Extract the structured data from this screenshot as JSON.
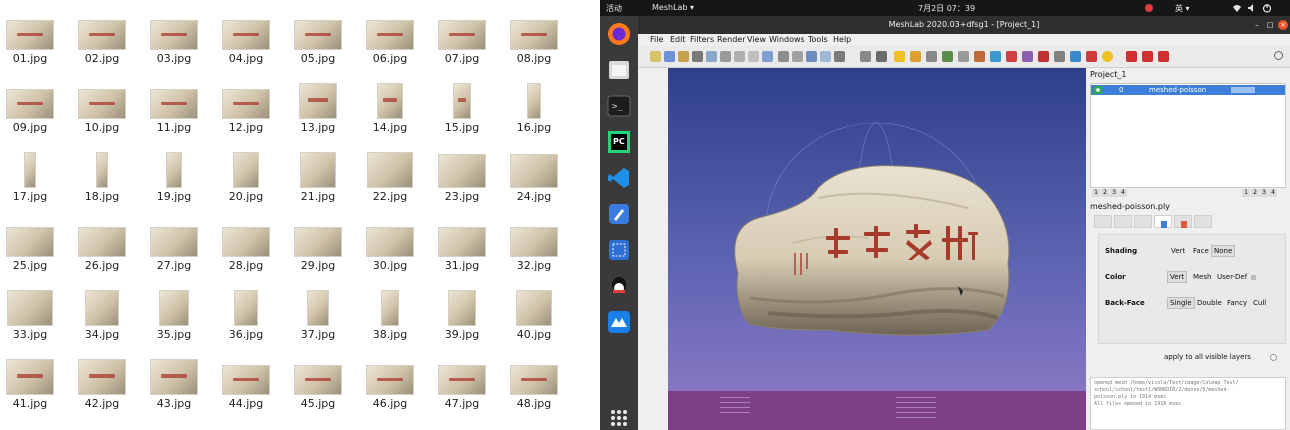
{
  "files": [
    {
      "name": "01.jpg",
      "w": 48,
      "h": 30,
      "text": true
    },
    {
      "name": "02.jpg",
      "w": 48,
      "h": 30,
      "text": true
    },
    {
      "name": "03.jpg",
      "w": 48,
      "h": 30,
      "text": true
    },
    {
      "name": "04.jpg",
      "w": 48,
      "h": 30,
      "text": true
    },
    {
      "name": "05.jpg",
      "w": 48,
      "h": 30,
      "text": true
    },
    {
      "name": "06.jpg",
      "w": 48,
      "h": 30,
      "text": true
    },
    {
      "name": "07.jpg",
      "w": 48,
      "h": 30,
      "text": true
    },
    {
      "name": "08.jpg",
      "w": 48,
      "h": 30,
      "text": true
    },
    {
      "name": "09.jpg",
      "w": 48,
      "h": 30,
      "text": true
    },
    {
      "name": "10.jpg",
      "w": 48,
      "h": 30,
      "text": true
    },
    {
      "name": "11.jpg",
      "w": 48,
      "h": 30,
      "text": true
    },
    {
      "name": "12.jpg",
      "w": 48,
      "h": 30,
      "text": true
    },
    {
      "name": "13.jpg",
      "w": 38,
      "h": 46,
      "text": true
    },
    {
      "name": "14.jpg",
      "w": 26,
      "h": 46,
      "text": true
    },
    {
      "name": "15.jpg",
      "w": 18,
      "h": 46,
      "text": true
    },
    {
      "name": "16.jpg",
      "w": 14,
      "h": 46,
      "text": false
    },
    {
      "name": "17.jpg",
      "w": 12,
      "h": 46,
      "text": false
    },
    {
      "name": "18.jpg",
      "w": 12,
      "h": 46,
      "text": false
    },
    {
      "name": "19.jpg",
      "w": 16,
      "h": 46,
      "text": false
    },
    {
      "name": "20.jpg",
      "w": 26,
      "h": 46,
      "text": false
    },
    {
      "name": "21.jpg",
      "w": 36,
      "h": 46,
      "text": false
    },
    {
      "name": "22.jpg",
      "w": 46,
      "h": 46,
      "text": false
    },
    {
      "name": "23.jpg",
      "w": 48,
      "h": 34,
      "text": false
    },
    {
      "name": "24.jpg",
      "w": 48,
      "h": 34,
      "text": false
    },
    {
      "name": "25.jpg",
      "w": 48,
      "h": 30,
      "text": false
    },
    {
      "name": "26.jpg",
      "w": 48,
      "h": 30,
      "text": false
    },
    {
      "name": "27.jpg",
      "w": 48,
      "h": 30,
      "text": false
    },
    {
      "name": "28.jpg",
      "w": 48,
      "h": 30,
      "text": false
    },
    {
      "name": "29.jpg",
      "w": 48,
      "h": 30,
      "text": false
    },
    {
      "name": "30.jpg",
      "w": 48,
      "h": 30,
      "text": false
    },
    {
      "name": "31.jpg",
      "w": 48,
      "h": 30,
      "text": false
    },
    {
      "name": "32.jpg",
      "w": 48,
      "h": 30,
      "text": false
    },
    {
      "name": "33.jpg",
      "w": 46,
      "h": 46,
      "text": false
    },
    {
      "name": "34.jpg",
      "w": 34,
      "h": 46,
      "text": false
    },
    {
      "name": "35.jpg",
      "w": 30,
      "h": 46,
      "text": false
    },
    {
      "name": "36.jpg",
      "w": 24,
      "h": 46,
      "text": false
    },
    {
      "name": "37.jpg",
      "w": 22,
      "h": 46,
      "text": false
    },
    {
      "name": "38.jpg",
      "w": 18,
      "h": 46,
      "text": false
    },
    {
      "name": "39.jpg",
      "w": 28,
      "h": 46,
      "text": false
    },
    {
      "name": "40.jpg",
      "w": 36,
      "h": 46,
      "text": false
    },
    {
      "name": "41.jpg",
      "w": 48,
      "h": 40,
      "text": true
    },
    {
      "name": "42.jpg",
      "w": 48,
      "h": 40,
      "text": true
    },
    {
      "name": "43.jpg",
      "w": 48,
      "h": 40,
      "text": true
    },
    {
      "name": "44.jpg",
      "w": 48,
      "h": 30,
      "text": true
    },
    {
      "name": "45.jpg",
      "w": 48,
      "h": 30,
      "text": true
    },
    {
      "name": "46.jpg",
      "w": 48,
      "h": 30,
      "text": true
    },
    {
      "name": "47.jpg",
      "w": 48,
      "h": 30,
      "text": true
    },
    {
      "name": "48.jpg",
      "w": 48,
      "h": 30,
      "text": true
    }
  ],
  "topbar": {
    "activities": "活动",
    "app_menu": "MeshLab ▾",
    "clock": "7月2日 07：39",
    "input_method": "英 ▾"
  },
  "window": {
    "title": "MeshLab 2020.03+dfsg1 - [Project_1]"
  },
  "menu": [
    "File",
    "Edit",
    "Filters",
    "Render",
    "View",
    "Windows",
    "Tools",
    "Help"
  ],
  "panel": {
    "project_title": "Project_1",
    "layer": {
      "index": "0",
      "name": "meshed-poisson"
    },
    "pager_left": [
      "1",
      "2",
      "3",
      "4"
    ],
    "pager_right": [
      "1",
      "2",
      "3",
      "4"
    ],
    "mesh_name": "meshed-poisson.ply",
    "shading_label": "Shading",
    "shading_options": [
      "Vert",
      "Face",
      "None"
    ],
    "color_label": "Color",
    "color_options": [
      "Vert",
      "Mesh",
      "User-Def"
    ],
    "backface_label": "Back-Face",
    "backface_options": [
      "Single",
      "Double",
      "Fancy",
      "Cull"
    ],
    "apply_label": "apply to all visible layers"
  },
  "log_lines": [
    "opened mesh /home/vicola/Test/image/Colmap_Test/",
    "school/school/test1/WORKDIR/2/dense/0/meshed-",
    "poisson.ply in 1914 msec",
    "All files opened in 1918 msec"
  ],
  "colors": {
    "selection": "#3d7ed8",
    "viewport_top": "#2f3f8a",
    "viewport_footer": "#7c3f88",
    "stone_text": "#a83a2c"
  }
}
